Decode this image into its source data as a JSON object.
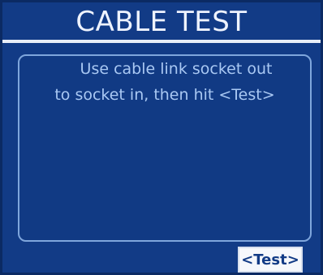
{
  "screen": {
    "title": "CABLE TEST",
    "message": {
      "line1": "Use cable link socket out",
      "line2": "to socket in, then hit <Test>"
    },
    "test_button_label": "<Test>"
  },
  "colors": {
    "background": "#123b86",
    "title_text": "#eef3ff",
    "message_text": "#a9c8f3",
    "panel_border": "#7fa6dc",
    "button_bg": "#f6f8fc",
    "button_text": "#123b86"
  }
}
